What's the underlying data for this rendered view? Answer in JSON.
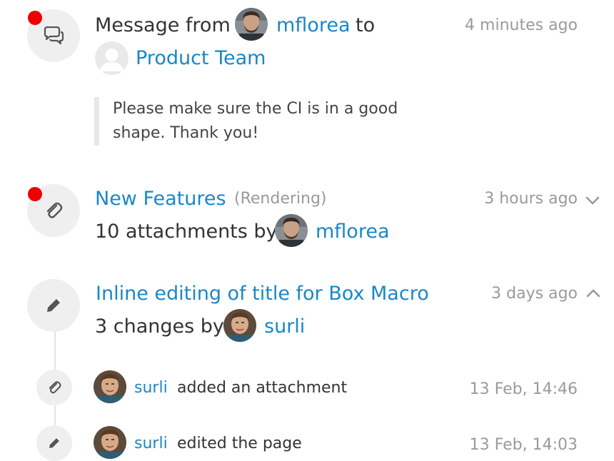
{
  "items": [
    {
      "type": "message",
      "prefix": "Message from",
      "author": "mflorea",
      "to_word": "to",
      "recipient": "Product Team",
      "time": "4 minutes ago",
      "quote": "Please make sure the CI is in a good shape. Thank you!",
      "unread": true,
      "icon": "chat-icon"
    },
    {
      "type": "attachments",
      "title": "New Features",
      "tag": "(Rendering)",
      "summary": "10 attachments by",
      "author": "mflorea",
      "time": "3 hours ago",
      "unread": true,
      "expanded": false,
      "icon": "paperclip-icon"
    },
    {
      "type": "edits",
      "title": "Inline editing of title for Box Macro",
      "summary": "3 changes by",
      "author": "surli",
      "time": "3 days ago",
      "unread": false,
      "expanded": true,
      "icon": "pencil-icon",
      "details": [
        {
          "author": "surli",
          "action": "added an attachment",
          "time": "13 Feb, 14:46",
          "icon": "paperclip-icon"
        },
        {
          "author": "surli",
          "action": "edited the page",
          "time": "13 Feb, 14:03",
          "icon": "pencil-icon"
        }
      ]
    }
  ],
  "colors": {
    "link": "#1a87c8",
    "unread_dot": "#ee0000",
    "icon_bg": "#efefef",
    "muted": "#999999"
  }
}
